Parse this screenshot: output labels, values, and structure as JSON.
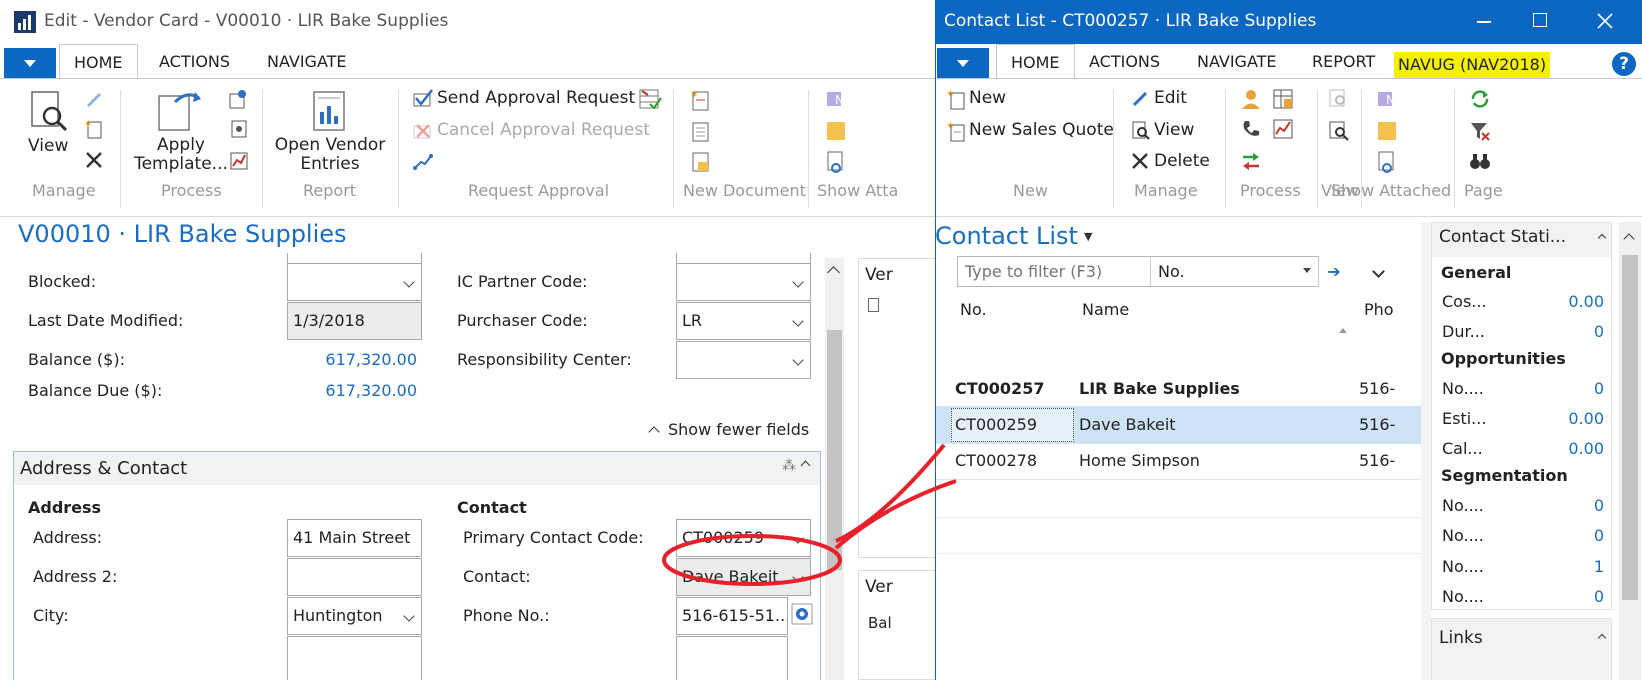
{
  "vendor_window": {
    "title": "Edit - Vendor Card - V00010 · LIR Bake Supplies",
    "tabs": [
      "HOME",
      "ACTIONS",
      "NAVIGATE"
    ],
    "ribbon": {
      "manage": {
        "view_label": "View",
        "group_label": "Manage"
      },
      "process": {
        "apply_template_label": "Apply Template...",
        "group_label": "Process"
      },
      "report": {
        "open_vendor_entries_label": "Open Vendor Entries",
        "group_label": "Report"
      },
      "request_approval": {
        "send_label": "Send Approval Request",
        "cancel_label": "Cancel Approval Request",
        "group_label": "Request Approval"
      },
      "new_document": {
        "group_label": "New Document"
      },
      "show_attached": {
        "group_label": "Show Atta"
      }
    },
    "page_title": "V00010 · LIR Bake Supplies",
    "general": {
      "blocked_label": "Blocked:",
      "blocked_value": "",
      "last_modified_label": "Last Date Modified:",
      "last_modified_value": "1/3/2018",
      "balance_label": "Balance ($):",
      "balance_value": "617,320.00",
      "balance_due_label": "Balance Due ($):",
      "balance_due_value": "617,320.00",
      "ic_partner_label": "IC Partner Code:",
      "ic_partner_value": "",
      "purchaser_label": "Purchaser Code:",
      "purchaser_value": "LR",
      "resp_center_label": "Responsibility Center:",
      "resp_center_value": "",
      "show_fewer_label": "Show fewer fields"
    },
    "address_contact": {
      "section_title": "Address & Contact",
      "address_heading": "Address",
      "contact_heading": "Contact",
      "address_label": "Address:",
      "address_value": "41 Main Street",
      "address2_label": "Address 2:",
      "address2_value": "",
      "city_label": "City:",
      "city_value": "Huntington",
      "primary_contact_label": "Primary Contact Code:",
      "primary_contact_value": "CT000259",
      "contact_label": "Contact:",
      "contact_value": "Dave Bakeit",
      "phone_label": "Phone No.:",
      "phone_value": "516-615-51..."
    },
    "factbox_partial": {
      "title1": "Ver",
      "title2": "Ver",
      "bal": "Bal"
    }
  },
  "contact_window": {
    "title": "Contact List - CT000257 · LIR Bake Supplies",
    "tabs": [
      "HOME",
      "ACTIONS",
      "NAVIGATE",
      "REPORT"
    ],
    "company_badge": "NAVUG (NAV2018)",
    "ribbon": {
      "new_label": "New",
      "new_sales_quote_label": "New Sales Quote",
      "new_group": "New",
      "edit_label": "Edit",
      "view_label": "View",
      "delete_label": "Delete",
      "manage_group": "Manage",
      "process_group": "Process",
      "view_group": "View",
      "show_attached_group": "Show Attached",
      "page_group": "Page"
    },
    "list_title": "Contact List",
    "filter": {
      "placeholder": "Type to filter (F3)",
      "field": "No."
    },
    "columns": [
      "No.",
      "Name",
      "Pho"
    ],
    "rows": [
      {
        "no": "CT000257",
        "name": "LIR Bake Supplies",
        "phone": "516-",
        "bold": true
      },
      {
        "no": "CT000259",
        "name": "Dave Bakeit",
        "phone": "516-",
        "selected": true
      },
      {
        "no": "CT000278",
        "name": "Home Simpson",
        "phone": "516-"
      }
    ],
    "factbox": {
      "title": "Contact Stati...",
      "general_heading": "General",
      "general": [
        {
          "k": "Cos...",
          "v": "0.00"
        },
        {
          "k": "Dur...",
          "v": "0"
        }
      ],
      "opp_heading": "Opportunities",
      "opportunities": [
        {
          "k": "No....",
          "v": "0"
        },
        {
          "k": "Esti...",
          "v": "0.00"
        },
        {
          "k": "Cal...",
          "v": "0.00"
        }
      ],
      "seg_heading": "Segmentation",
      "segmentation": [
        {
          "k": "No....",
          "v": "0"
        },
        {
          "k": "No....",
          "v": "0"
        },
        {
          "k": "No....",
          "v": "1"
        },
        {
          "k": "No....",
          "v": "0"
        }
      ],
      "links_title": "Links"
    }
  },
  "colors": {
    "accent": "#0b67c2",
    "link": "#1a6dc2",
    "annotation": "#e8202a",
    "badge": "#f5f000"
  }
}
